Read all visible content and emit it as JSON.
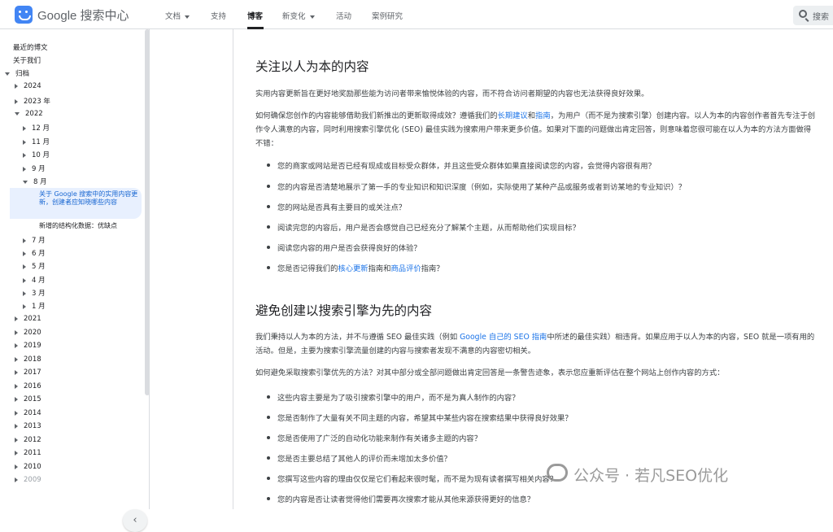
{
  "header": {
    "brand": "Google 搜索中心",
    "tabs": [
      {
        "label": "文档",
        "dropdown": true
      },
      {
        "label": "支持"
      },
      {
        "label": "博客",
        "active": true
      },
      {
        "label": "新变化",
        "dropdown": true
      },
      {
        "label": "活动"
      },
      {
        "label": "案例研究"
      }
    ],
    "search_label": "搜索"
  },
  "sidebar": {
    "top_links": [
      "最近的博文",
      "关于我们"
    ],
    "archive_label": "归档",
    "years_before": [
      "2024",
      "2023 年"
    ],
    "expanded_year": "2022",
    "months_before": [
      "12 月",
      "11 月",
      "10 月",
      "9 月"
    ],
    "expanded_month": "8 月",
    "active_post": "关于 Google 搜索中的实用内容更新，创建者应知晓哪些内容",
    "next_post": "新增的结构化数据：优缺点",
    "months_after": [
      "7 月",
      "6 月",
      "5 月",
      "4 月",
      "3 月",
      "1 月"
    ],
    "years_after": [
      "2021",
      "2020",
      "2019",
      "2018",
      "2017",
      "2016",
      "2015",
      "2014",
      "2013",
      "2012",
      "2011",
      "2010",
      "2009"
    ],
    "collapse_icon": "‹"
  },
  "article": {
    "section1_title": "关注以人为本的内容",
    "section1_intro": "实用内容更新旨在更好地奖励那些能为访问者带来愉悦体验的内容，而不符合访问者期望的内容也无法获得良好效果。",
    "section1_p2_a": "如何确保您创作的内容能够借助我们新推出的更新取得成效？遵循我们的",
    "section1_p2_link1": "长期建议",
    "section1_p2_and": "和",
    "section1_p2_link2": "指南",
    "section1_p2_b": "，为用户（而不是为搜索引擎）创建内容。以人为本的内容创作者首先专注于创作令人满意的内容，同时利用搜索引擎优化 (SEO) 最佳实践为搜索用户带来更多价值。如果对下面的问题做出肯定回答，则意味着您很可能在以人为本的方法方面做得不错：",
    "section1_items": [
      "您的商家或网站是否已经有现成或目标受众群体，并且这些受众群体如果直接阅读您的内容，会觉得内容很有用？",
      "您的内容是否清楚地展示了第一手的专业知识和知识深度（例如，实际使用了某种产品或服务或者到访某地的专业知识）？",
      "您的网站是否具有主要目的或关注点？",
      "阅读完您的内容后，用户是否会感觉自己已经充分了解某个主题，从而帮助他们实现目标？",
      "阅读您内容的用户是否会获得良好的体验？"
    ],
    "section1_last_a": "您是否记得我们的",
    "section1_last_link1": "核心更新",
    "section1_last_b": "指南和",
    "section1_last_link2": "商品评价",
    "section1_last_c": "指南？",
    "section2_title": "避免创建以搜索引擎为先的内容",
    "section2_p1_a": "我们秉持以人为本的方法，并不与遵循 SEO 最佳实践（例如 ",
    "section2_p1_link": "Google 自己的 SEO 指南",
    "section2_p1_b": "中所述的最佳实践）相违背。如果应用于以人为本的内容，SEO 就是一项有用的活动。但是，主要为搜索引擎流量创建的内容与搜索者发现不满意的内容密切相关。",
    "section2_p2": "如何避免采取搜索引擎优先的方法？对其中部分或全部问题做出肯定回答是一条警告迹象，表示您应重新评估在整个网站上创作内容的方式：",
    "section2_items": [
      "这些内容主要是为了吸引搜索引擎中的用户，而不是为真人制作的内容？",
      "您是否制作了大量有关不同主题的内容，希望其中某些内容在搜索结果中获得良好效果？",
      "您是否使用了广泛的自动化功能来制作有关诸多主题的内容？",
      "您是否主要总结了其他人的评价而未增加太多价值？",
      "您撰写这些内容的理由仅仅是它们看起来很时髦，而不是为现有读者撰写相关内容？",
      "您的内容是否让读者觉得他们需要再次搜索才能从其他来源获得更好的信息？"
    ]
  },
  "watermark": {
    "text": "公众号 · 若凡SEO优化"
  }
}
